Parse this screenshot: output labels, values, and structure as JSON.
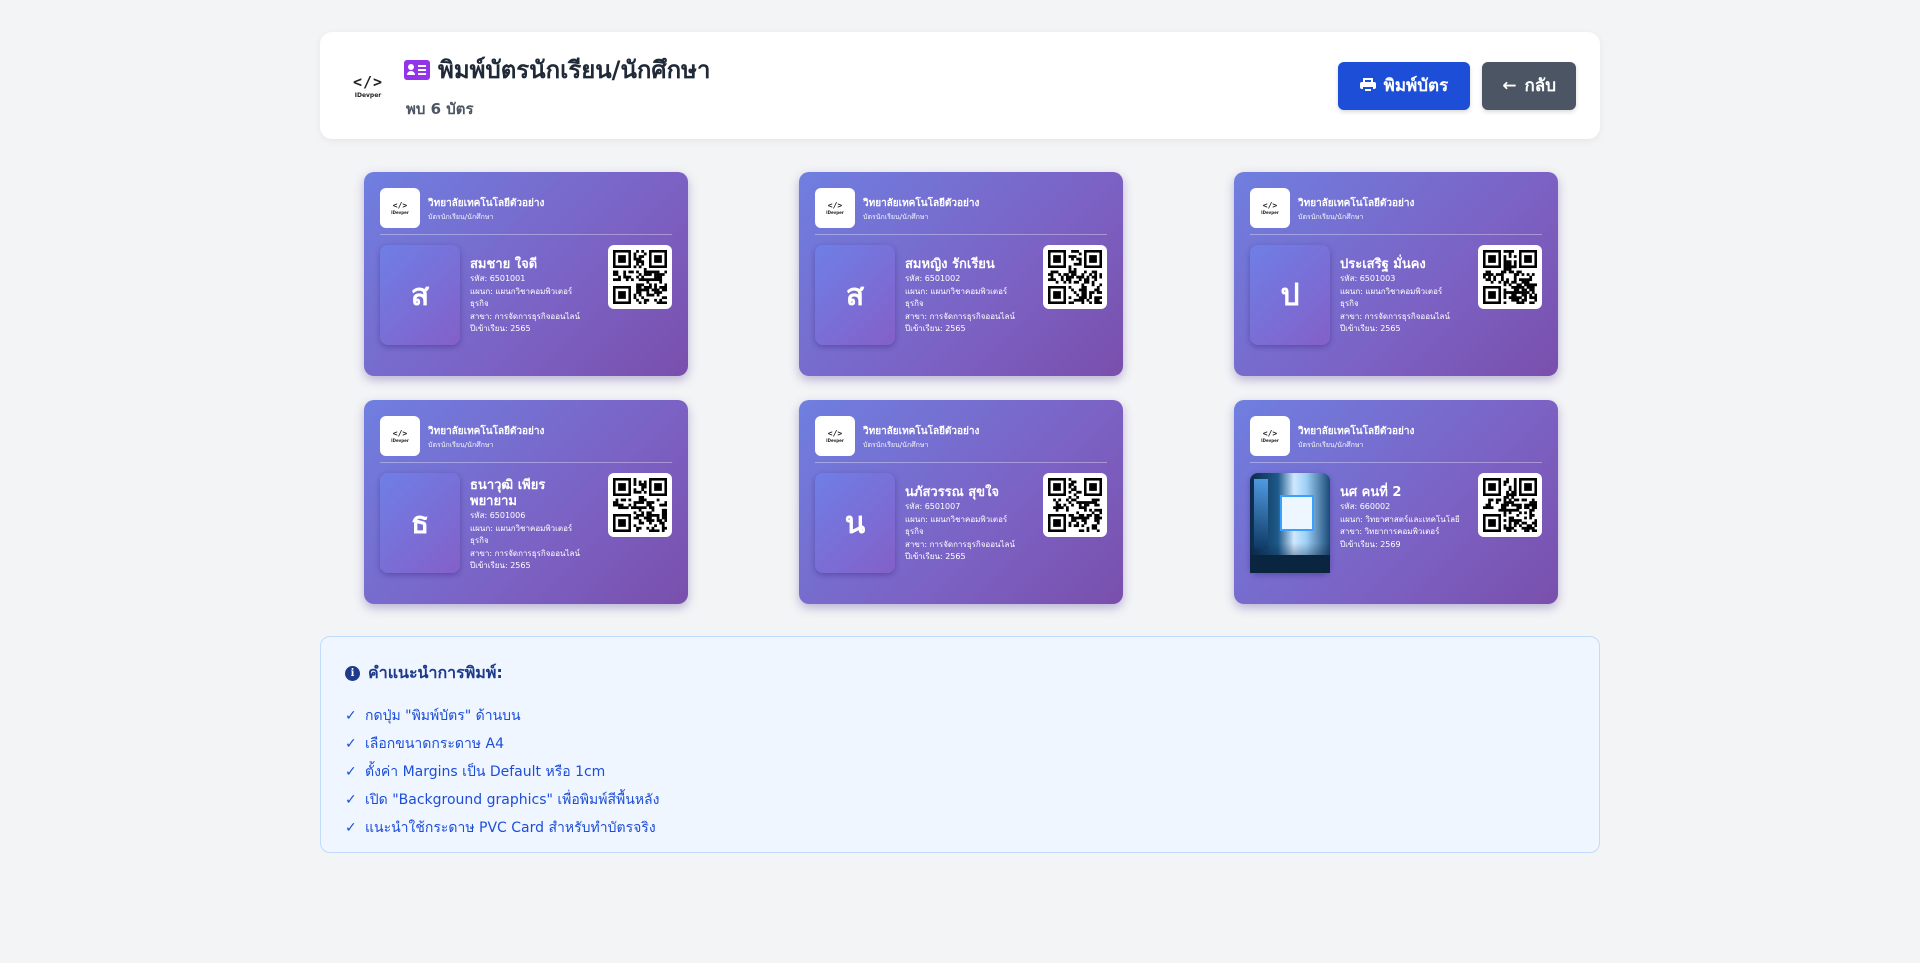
{
  "header": {
    "logo_code": "</>",
    "logo_brand": "IDevper",
    "title": "พิมพ์บัตรนักเรียน/นักศึกษา",
    "subtitle": "พบ 6 บัตร",
    "print_label": "พิมพ์บัตร",
    "back_label": "กลับ"
  },
  "cards": [
    {
      "org": "วิทยาลัยเทคโนโลยีตัวอย่าง",
      "card_type": "บัตรนักเรียน/นักศึกษา",
      "initial": "ส",
      "name": "สมชาย ใจดี",
      "code": "รหัส: 6501001",
      "dept": "แผนก: แผนกวิชาคอมพิวเตอร์ธุรกิจ",
      "major": "สาขา: การจัดการธุรกิจออนไลน์",
      "year": "ปีเข้าเรียน: 2565",
      "photo": false
    },
    {
      "org": "วิทยาลัยเทคโนโลยีตัวอย่าง",
      "card_type": "บัตรนักเรียน/นักศึกษา",
      "initial": "ส",
      "name": "สมหญิง รักเรียน",
      "code": "รหัส: 6501002",
      "dept": "แผนก: แผนกวิชาคอมพิวเตอร์ธุรกิจ",
      "major": "สาขา: การจัดการธุรกิจออนไลน์",
      "year": "ปีเข้าเรียน: 2565",
      "photo": false
    },
    {
      "org": "วิทยาลัยเทคโนโลยีตัวอย่าง",
      "card_type": "บัตรนักเรียน/นักศึกษา",
      "initial": "ป",
      "name": "ประเสริฐ มั่นคง",
      "code": "รหัส: 6501003",
      "dept": "แผนก: แผนกวิชาคอมพิวเตอร์ธุรกิจ",
      "major": "สาขา: การจัดการธุรกิจออนไลน์",
      "year": "ปีเข้าเรียน: 2565",
      "photo": false
    },
    {
      "org": "วิทยาลัยเทคโนโลยีตัวอย่าง",
      "card_type": "บัตรนักเรียน/นักศึกษา",
      "initial": "ธ",
      "name": "ธนาวุฒิ เพียรพยายาม",
      "code": "รหัส: 6501006",
      "dept": "แผนก: แผนกวิชาคอมพิวเตอร์ธุรกิจ",
      "major": "สาขา: การจัดการธุรกิจออนไลน์",
      "year": "ปีเข้าเรียน: 2565",
      "photo": false
    },
    {
      "org": "วิทยาลัยเทคโนโลยีตัวอย่าง",
      "card_type": "บัตรนักเรียน/นักศึกษา",
      "initial": "น",
      "name": "นภัสวรรณ สุขใจ",
      "code": "รหัส: 6501007",
      "dept": "แผนก: แผนกวิชาคอมพิวเตอร์ธุรกิจ",
      "major": "สาขา: การจัดการธุรกิจออนไลน์",
      "year": "ปีเข้าเรียน: 2565",
      "photo": false
    },
    {
      "org": "วิทยาลัยเทคโนโลยีตัวอย่าง",
      "card_type": "บัตรนักเรียน/นักศึกษา",
      "initial": "",
      "name": "นศ คนที่ 2",
      "code": "รหัส: 660002",
      "dept": "แผนก: วิทยาศาสตร์และเทคโนโลยี",
      "major": "สาขา: วิทยาการคอมพิวเตอร์",
      "year": "ปีเข้าเรียน: 2569",
      "photo": true
    }
  ],
  "instructions": {
    "title": "คำแนะนำการพิมพ์:",
    "items": [
      "กดปุ่ม \"พิมพ์บัตร\" ด้านบน",
      "เลือกขนาดกระดาษ A4",
      "ตั้งค่า Margins เป็น Default หรือ 1cm",
      "เปิด \"Background graphics\" เพื่อพิมพ์สีพื้นหลัง",
      "แนะนำใช้กระดาษ PVC Card สำหรับทำบัตรจริง"
    ]
  }
}
